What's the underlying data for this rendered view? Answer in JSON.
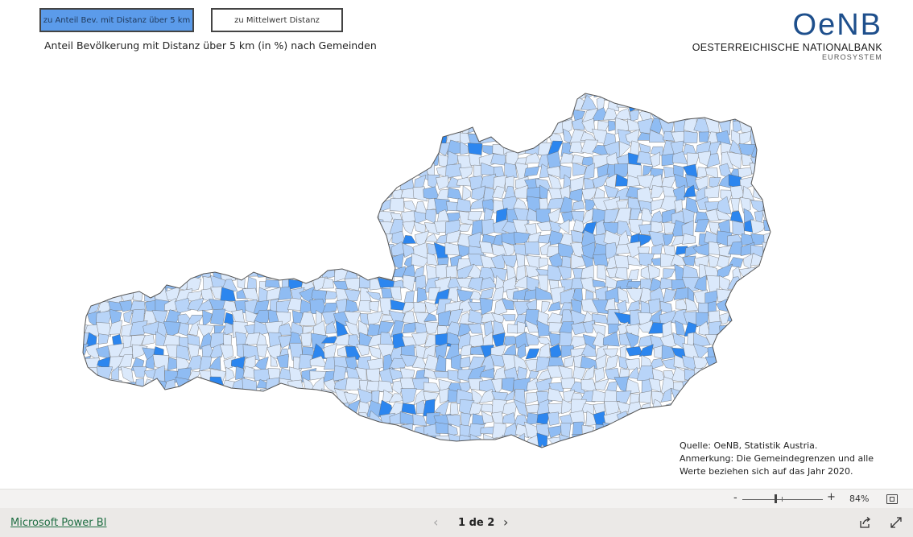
{
  "buttons": {
    "share_option": "zu Anteil Bev. mit Distanz über 5 km",
    "mean_option": "zu Mittelwert Distanz"
  },
  "map": {
    "title": "Anteil Bevölkerung mit Distanz über 5 km (in %) nach Gemeinden",
    "region": "Österreich – Gemeinden",
    "colors": {
      "low": "#dbe9fb",
      "mid": "#b8d4f8",
      "high": "#8fbcf3",
      "max": "#2c86ef",
      "border": "#666666"
    }
  },
  "logo": {
    "mark": "OeNB",
    "name": "OESTERREICHISCHE NATIONALBANK",
    "sub": "EUROSYSTEM"
  },
  "notes": {
    "source": "Quelle: OeNB, Statistik Austria.",
    "remark_line1": "Anmerkung: Die Gemeindegrenzen und alle",
    "remark_line2": "Werte beziehen sich auf das Jahr 2020."
  },
  "zoom": {
    "minus": "-",
    "plus": "+",
    "level": "84%"
  },
  "footer": {
    "brand": "Microsoft Power BI",
    "prev": "‹",
    "page": "1 de 2",
    "next": "›"
  }
}
